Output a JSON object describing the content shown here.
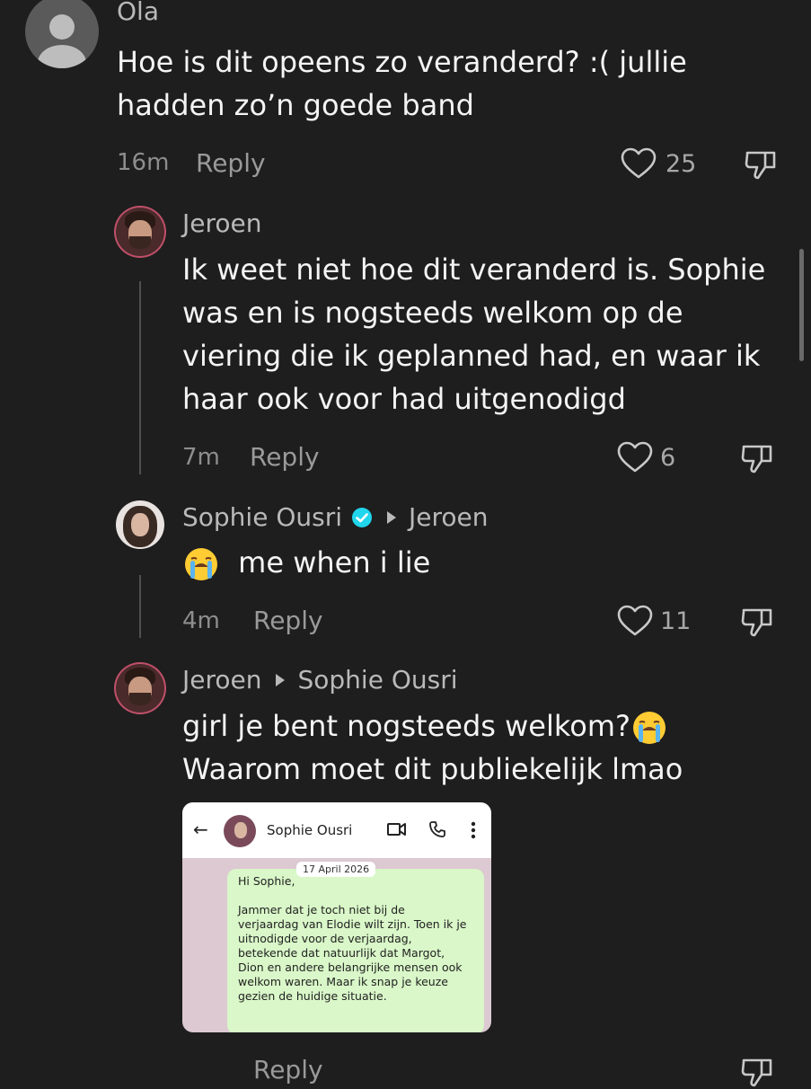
{
  "comments": [
    {
      "author": "Ola",
      "text": "Hoe is dit opeens zo veranderd? :( jullie hadden zo’n goede band",
      "time": "16m",
      "reply_label": "Reply",
      "likes": "25"
    },
    {
      "author": "Jeroen",
      "text": "Ik weet niet hoe dit veranderd is. Sophie was en is nogsteeds welkom op de viering die ik geplanned had, en waar ik haar ook voor had uitgenodigd",
      "time": "7m",
      "reply_label": "Reply",
      "likes": "6"
    },
    {
      "author": "Sophie Ousri",
      "reply_to": "Jeroen",
      "text": "me when i lie",
      "time": "4m",
      "reply_label": "Reply",
      "likes": "11"
    },
    {
      "author": "Jeroen",
      "reply_to": "Sophie Ousri",
      "text_line1": "girl je bent nogsteeds welkom?",
      "text_line2": "Waarom moet dit publiekelijk lmao",
      "reply_label": "Reply"
    }
  ],
  "attachment": {
    "contact_name": "Sophie Ousri",
    "date": "17 April 2026",
    "message": "Hi Sophie,\n\nJammer dat je toch niet bij de verjaardag van Elodie wilt zijn. Toen ik je uitnodigde voor de verjaardag, betekende dat natuurlijk dat Margot, Dion en andere belangrijke mensen ook welkom waren. Maar ik snap je keuze gezien de huidige situatie."
  },
  "colors": {
    "background": "#1e1e1e",
    "verified_badge": "#20d5ec"
  },
  "icons": [
    "user-placeholder-icon",
    "heart-icon",
    "dislike-icon",
    "verified-badge-icon",
    "reply-arrow-icon",
    "crying-face-emoji",
    "back-arrow-icon",
    "video-call-icon",
    "phone-icon",
    "more-options-icon"
  ]
}
